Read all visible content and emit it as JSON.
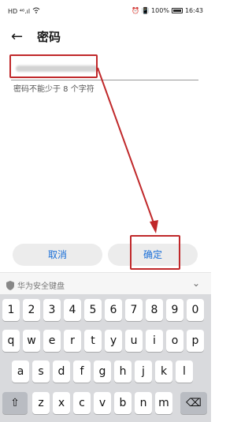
{
  "status_bar": {
    "left_indicators": "HD ⁴⁶.ıl",
    "right_indicators": "⏰ 📳 100%",
    "time": "16:43"
  },
  "header": {
    "title": "密码"
  },
  "password_field": {
    "hint": "密码不能少于 8 个字符"
  },
  "actions": {
    "cancel_label": "取消",
    "confirm_label": "确定"
  },
  "keyboard_bar": {
    "title": "华为安全键盘"
  },
  "keyboard": {
    "row1": [
      "1",
      "2",
      "3",
      "4",
      "5",
      "6",
      "7",
      "8",
      "9",
      "0"
    ],
    "row2": [
      "q",
      "w",
      "e",
      "r",
      "t",
      "y",
      "u",
      "i",
      "o",
      "p"
    ],
    "row3": [
      "a",
      "s",
      "d",
      "f",
      "g",
      "h",
      "j",
      "k",
      "l"
    ],
    "row4": [
      "z",
      "x",
      "c",
      "v",
      "b",
      "n",
      "m"
    ]
  },
  "icons": {
    "back": "back-arrow-icon",
    "shield": "shield-icon",
    "hide": "chevron-down-icon",
    "shift": "shift-icon",
    "delete": "backspace-icon"
  },
  "colors": {
    "accent": "#1a6fd8",
    "annotation": "#c0282a"
  }
}
